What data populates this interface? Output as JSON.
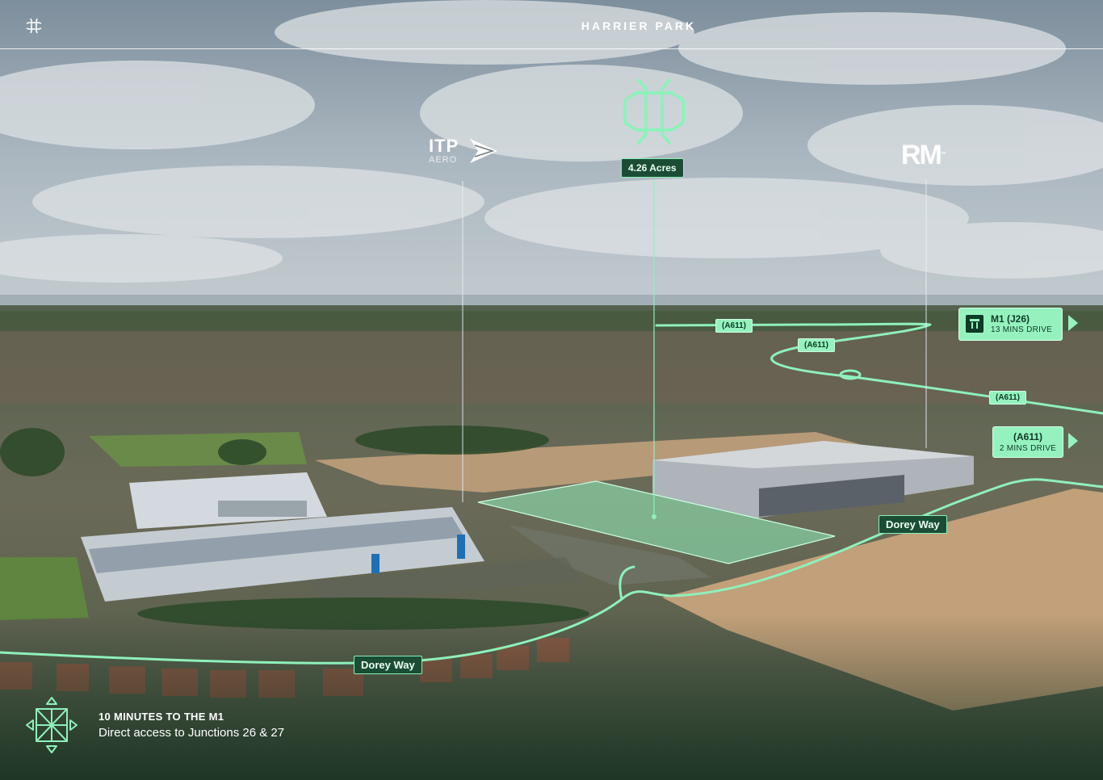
{
  "header": {
    "title": "HARRIER PARK",
    "mark_icon": "hash-logo-icon"
  },
  "site": {
    "area_label": "4.26 Acres"
  },
  "neighbours": [
    {
      "name": "ITP",
      "sub": "AERO"
    },
    {
      "name": "RM",
      "mark": "™"
    }
  ],
  "roads": {
    "a611_labels": [
      "(A611)",
      "(A611)",
      "(A611)"
    ],
    "dorey_way_labels": [
      "Dorey Way",
      "Dorey Way"
    ]
  },
  "destinations": [
    {
      "title": "M1 (J26)",
      "subtitle": "13 MINS DRIVE",
      "icon": "motorway-icon"
    },
    {
      "title": "(A611)",
      "subtitle": "2 MINS DRIVE"
    }
  ],
  "footer": {
    "heading": "10 MINUTES TO THE M1",
    "subheading": "Direct access to Junctions 26 & 27",
    "icon": "motorway-junction-icon"
  },
  "colors": {
    "accent": "#95f2bf",
    "accent_dark": "#1b4d35",
    "route_line": "#8ff0bb",
    "text_light": "#ffffff"
  }
}
